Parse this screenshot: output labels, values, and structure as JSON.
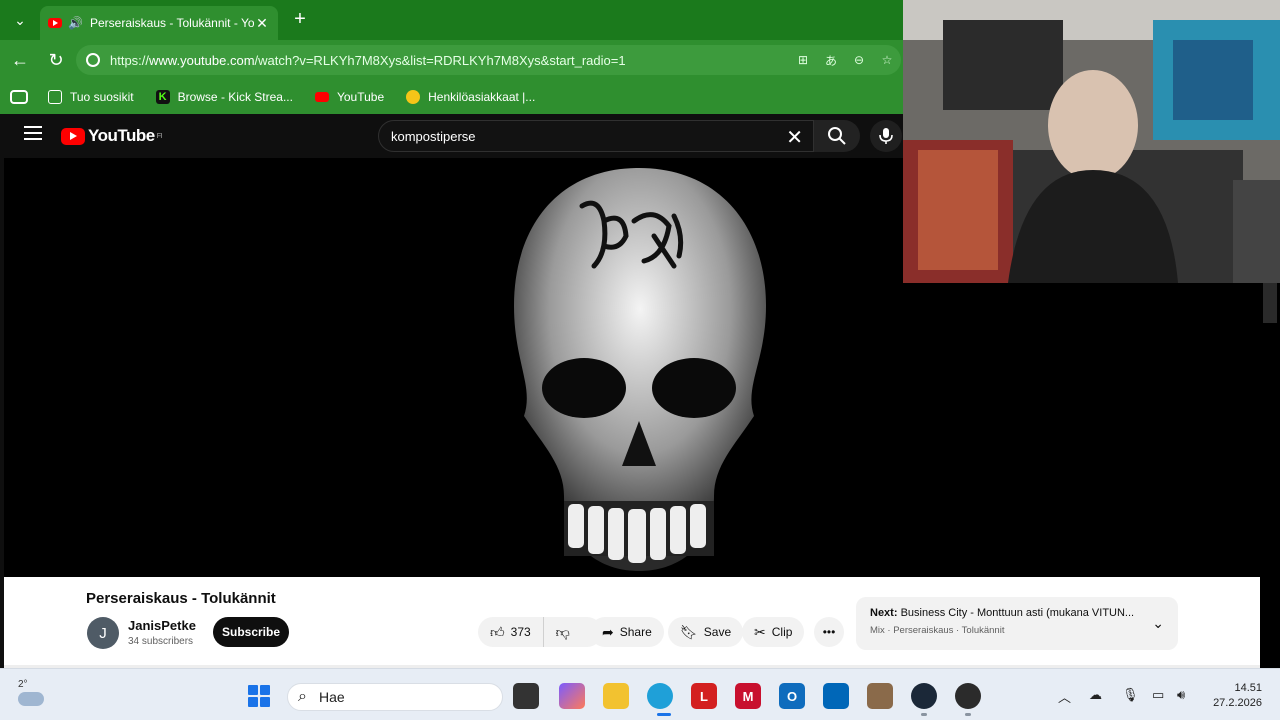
{
  "browser": {
    "tab_title": "Perseraiskaus - Tolukännit - YouTube",
    "url_prefix": "https://",
    "url_host": "www.youtube.com",
    "url_path": "/watch?v=RLKYh7M8Xys&list=RDRLKYh7M8Xys&start_radio=1",
    "bookmarks": [
      "Tuo suosikit",
      "Browse - Kick Strea...",
      "YouTube",
      "Henkilöasiakkaat |..."
    ]
  },
  "youtube": {
    "logo_text": "YouTube",
    "region": "FI",
    "search_value": "kompostiperse",
    "video_title": "Perseraiskaus - Tolukännit",
    "channel_initial": "J",
    "channel_name": "JanisPetke",
    "subscribers": "34 subscribers",
    "subscribe_label": "Subscribe",
    "likes": "373",
    "share_label": "Share",
    "save_label": "Save",
    "clip_label": "Clip",
    "next_label": "Next:",
    "next_title": "Business City - Monttuun asti (mukana VITUN...",
    "next_sub": "Mix · Perseraiskaus · Tolukännit"
  },
  "taskbar": {
    "temperature": "2°",
    "search_placeholder": "Hae",
    "time": "14.51",
    "date": "27.2.2026"
  },
  "colors": {
    "chrome_green": "#2f8f2f",
    "tab_green": "#1b7a1c",
    "youtube_red": "#ff0000"
  }
}
